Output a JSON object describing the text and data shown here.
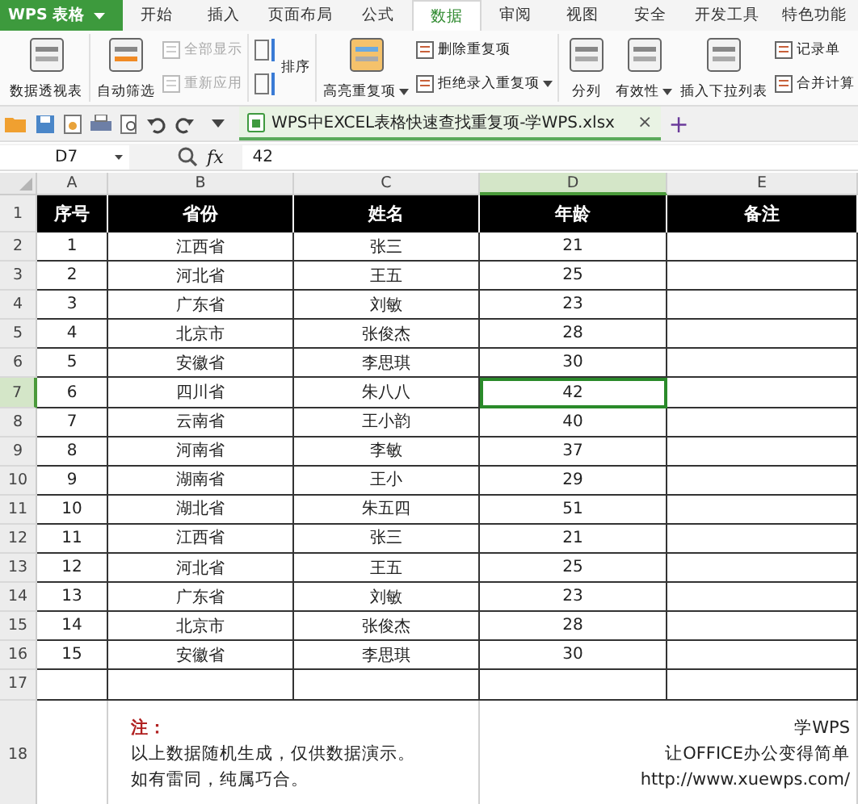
{
  "app_button": {
    "label": "WPS 表格"
  },
  "menu_tabs": [
    {
      "label": "开始",
      "selected": false
    },
    {
      "label": "插入",
      "selected": false
    },
    {
      "label": "页面布局",
      "selected": false
    },
    {
      "label": "公式",
      "selected": false
    },
    {
      "label": "数据",
      "selected": true
    },
    {
      "label": "审阅",
      "selected": false
    },
    {
      "label": "视图",
      "selected": false
    },
    {
      "label": "安全",
      "selected": false
    },
    {
      "label": "开发工具",
      "selected": false
    },
    {
      "label": "特色功能",
      "selected": false
    }
  ],
  "ribbon_groups": [
    {
      "items": [
        {
          "kind": "large",
          "label": "数据透视表",
          "disabled": false,
          "dropdown": false
        }
      ]
    },
    {
      "items": [
        {
          "kind": "large",
          "label": "自动筛选",
          "disabled": false,
          "dropdown": false
        },
        {
          "kind": "small",
          "label": "全部显示",
          "disabled": true,
          "dropdown": false
        },
        {
          "kind": "small",
          "label": "重新应用",
          "disabled": true,
          "dropdown": false
        }
      ]
    },
    {
      "items": [
        {
          "kind": "sort",
          "label": "排序",
          "disabled": false
        }
      ]
    },
    {
      "items": [
        {
          "kind": "large",
          "label": "高亮重复项",
          "disabled": false,
          "dropdown": true
        },
        {
          "kind": "small",
          "label": "删除重复项",
          "disabled": false,
          "dropdown": false
        },
        {
          "kind": "small",
          "label": "拒绝录入重复项",
          "disabled": false,
          "dropdown": true
        }
      ]
    },
    {
      "items": [
        {
          "kind": "large",
          "label": "分列",
          "disabled": false,
          "dropdown": false
        },
        {
          "kind": "large",
          "label": "有效性",
          "disabled": false,
          "dropdown": true
        },
        {
          "kind": "large",
          "label": "插入下拉列表",
          "disabled": false,
          "dropdown": false
        },
        {
          "kind": "small",
          "label": "记录单",
          "disabled": false,
          "dropdown": false
        },
        {
          "kind": "small",
          "label": "合并计算",
          "disabled": false,
          "dropdown": false
        }
      ]
    }
  ],
  "file_tab": {
    "label": "WPS中EXCEL表格快速查找重复项-学WPS.xlsx",
    "close": "×",
    "add": "+"
  },
  "formula_bar": {
    "name_box": "D7",
    "fx": "fx",
    "value": "42"
  },
  "columns": [
    {
      "label": "A",
      "selected": false
    },
    {
      "label": "B",
      "selected": false
    },
    {
      "label": "C",
      "selected": false
    },
    {
      "label": "D",
      "selected": true
    },
    {
      "label": "E",
      "selected": false
    }
  ],
  "header_row": {
    "row_number": "1",
    "cells": [
      "序号",
      "省份",
      "姓名",
      "年龄",
      "备注"
    ]
  },
  "rows": [
    {
      "row_number": "2",
      "cells": [
        "1",
        "江西省",
        "张三",
        "21",
        ""
      ],
      "selected": false
    },
    {
      "row_number": "3",
      "cells": [
        "2",
        "河北省",
        "王五",
        "25",
        ""
      ],
      "selected": false
    },
    {
      "row_number": "4",
      "cells": [
        "3",
        "广东省",
        "刘敏",
        "23",
        ""
      ],
      "selected": false
    },
    {
      "row_number": "5",
      "cells": [
        "4",
        "北京市",
        "张俊杰",
        "28",
        ""
      ],
      "selected": false
    },
    {
      "row_number": "6",
      "cells": [
        "5",
        "安徽省",
        "李思琪",
        "30",
        ""
      ],
      "selected": false
    },
    {
      "row_number": "7",
      "cells": [
        "6",
        "四川省",
        "朱八八",
        "42",
        ""
      ],
      "selected": true
    },
    {
      "row_number": "8",
      "cells": [
        "7",
        "云南省",
        "王小韵",
        "40",
        ""
      ],
      "selected": false
    },
    {
      "row_number": "9",
      "cells": [
        "8",
        "河南省",
        "李敏",
        "37",
        ""
      ],
      "selected": false
    },
    {
      "row_number": "10",
      "cells": [
        "9",
        "湖南省",
        "王小",
        "29",
        ""
      ],
      "selected": false
    },
    {
      "row_number": "11",
      "cells": [
        "10",
        "湖北省",
        "朱五四",
        "51",
        ""
      ],
      "selected": false
    },
    {
      "row_number": "12",
      "cells": [
        "11",
        "江西省",
        "张三",
        "21",
        ""
      ],
      "selected": false
    },
    {
      "row_number": "13",
      "cells": [
        "12",
        "河北省",
        "王五",
        "25",
        ""
      ],
      "selected": false
    },
    {
      "row_number": "14",
      "cells": [
        "13",
        "广东省",
        "刘敏",
        "23",
        ""
      ],
      "selected": false
    },
    {
      "row_number": "15",
      "cells": [
        "14",
        "北京市",
        "张俊杰",
        "28",
        ""
      ],
      "selected": false
    },
    {
      "row_number": "16",
      "cells": [
        "15",
        "安徽省",
        "李思琪",
        "30",
        ""
      ],
      "selected": false
    },
    {
      "row_number": "17",
      "cells": [
        "",
        "",
        "",
        "",
        ""
      ],
      "selected": false
    }
  ],
  "note_row": {
    "row_number": "18",
    "note_title": "注：",
    "note_lines": [
      "以上数据随机生成，仅供数据演示。",
      "如有雷同，纯属巧合。"
    ],
    "credit_lines": [
      "学WPS",
      "让OFFICE办公变得简单",
      "http://www.xuewps.com/"
    ]
  }
}
